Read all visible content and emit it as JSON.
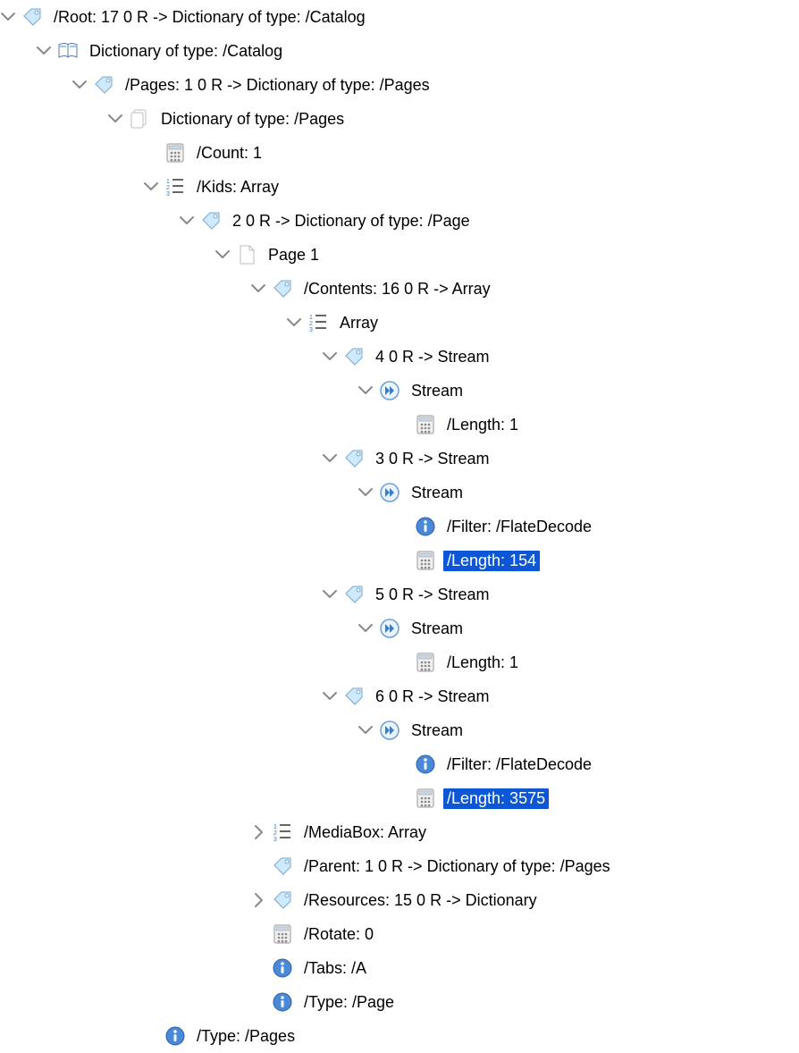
{
  "root": {
    "label": "/Root: 17 0 R -> Dictionary of type: /Catalog",
    "catalog": {
      "label": "Dictionary of type: /Catalog",
      "pages_ref": {
        "label": "/Pages: 1 0 R -> Dictionary of type: /Pages",
        "dict": {
          "label": "Dictionary of type: /Pages",
          "count": {
            "label": "/Count: 1"
          },
          "kids": {
            "label": "/Kids: Array",
            "item0": {
              "label": "2 0 R -> Dictionary of type: /Page",
              "page": {
                "label": "Page 1",
                "contents": {
                  "label": "/Contents: 16 0 R -> Array",
                  "array": {
                    "label": "Array",
                    "s0": {
                      "ref": "4 0 R -> Stream",
                      "stream": "Stream",
                      "length": "/Length: 1"
                    },
                    "s1": {
                      "ref": "3 0 R -> Stream",
                      "stream": "Stream",
                      "filter": "/Filter: /FlateDecode",
                      "length": "/Length: 154"
                    },
                    "s2": {
                      "ref": "5 0 R -> Stream",
                      "stream": "Stream",
                      "length": "/Length: 1"
                    },
                    "s3": {
                      "ref": "6 0 R -> Stream",
                      "stream": "Stream",
                      "filter": "/Filter: /FlateDecode",
                      "length": "/Length: 3575"
                    }
                  }
                },
                "mediabox": {
                  "label": "/MediaBox: Array"
                },
                "parent": {
                  "label": "/Parent: 1 0 R -> Dictionary of type: /Pages"
                },
                "resources": {
                  "label": "/Resources: 15 0 R -> Dictionary"
                },
                "rotate": {
                  "label": "/Rotate: 0"
                },
                "tabs": {
                  "label": "/Tabs: /A"
                },
                "type": {
                  "label": "/Type: /Page"
                }
              }
            }
          },
          "type": {
            "label": "/Type: /Pages"
          }
        }
      }
    }
  }
}
